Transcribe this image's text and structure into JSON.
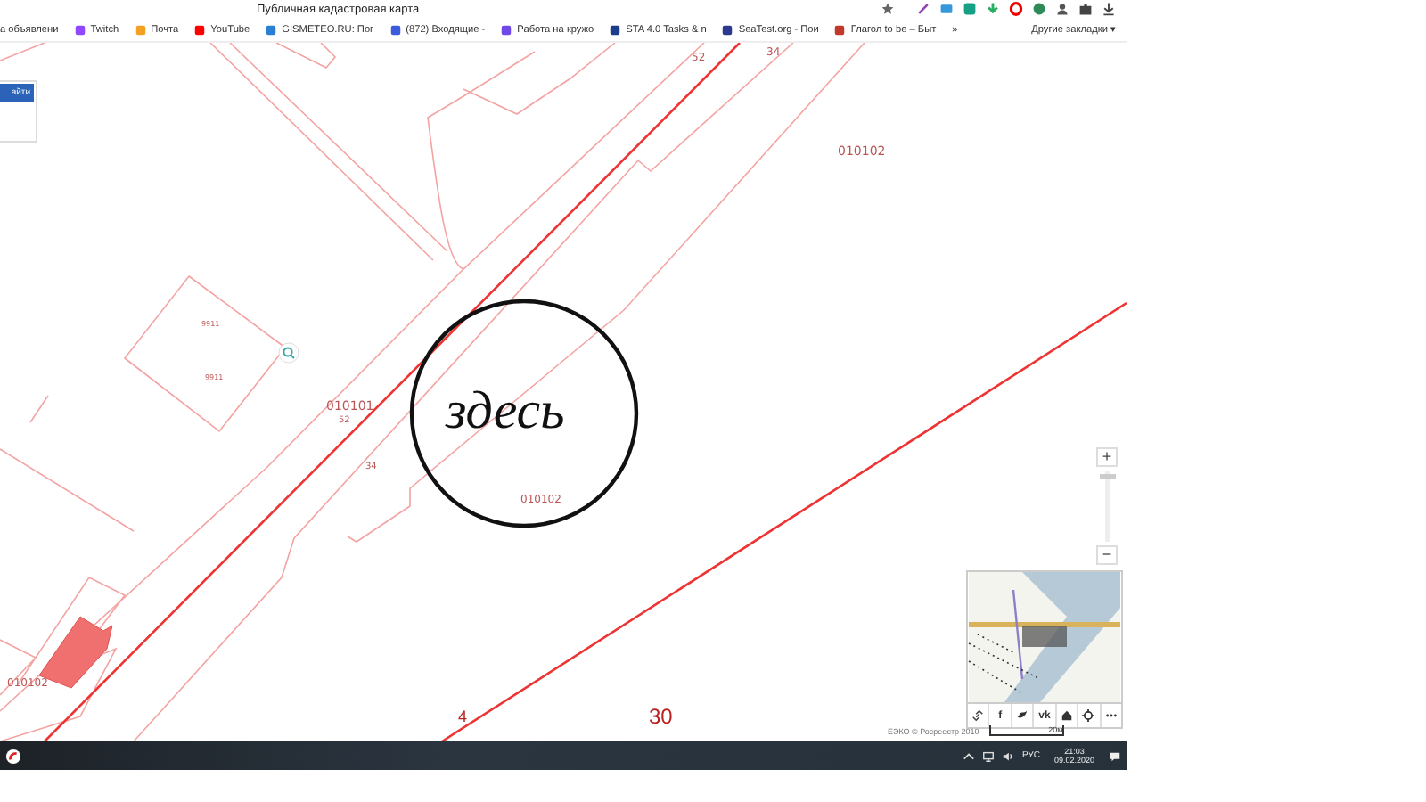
{
  "window": {
    "title": "Публичная кадастровая карта"
  },
  "bookmarks": [
    {
      "label": "а объявлени"
    },
    {
      "label": "Twitch",
      "color": "#9146ff"
    },
    {
      "label": "Почта",
      "color": "#f4a020"
    },
    {
      "label": "YouTube",
      "color": "#ff0000"
    },
    {
      "label": "GISMETEO.RU: Пог",
      "color": "#2a7fd4"
    },
    {
      "label": "(872) Входящие - ",
      "color": "#3b5bdb"
    },
    {
      "label": "Работа на кружо",
      "color": "#7048e8"
    },
    {
      "label": "STA 4.0 Tasks & n",
      "color": "#1c3d8c"
    },
    {
      "label": "SeaTest.org - Пои",
      "color": "#2b3a8c"
    },
    {
      "label": "Глагол to be – Быт",
      "color": "#c0392b"
    }
  ],
  "bookmarks_more": "»",
  "other_bookmarks": "Другие закладки ▾",
  "search": {
    "button": "айти"
  },
  "map": {
    "labels": [
      "52",
      "34",
      "010102",
      "9911",
      "9911",
      "010101",
      "52",
      "34",
      "010102",
      "010102",
      "4",
      "30"
    ],
    "annotation": "здесь"
  },
  "zoom": {
    "in": "+",
    "out": "−",
    "level": 0.95
  },
  "share_buttons": [
    {
      "kind": "link"
    },
    {
      "kind": "text",
      "label": "f"
    },
    {
      "kind": "bird"
    },
    {
      "kind": "text",
      "label": "vk"
    },
    {
      "kind": "home"
    },
    {
      "kind": "locate"
    },
    {
      "kind": "more"
    }
  ],
  "attribution": "ЕЭКО © Росреестр 2010",
  "scale": "20м",
  "taskbar": {
    "language": "РУС",
    "time": "21:03",
    "date": "09.02.2020"
  }
}
